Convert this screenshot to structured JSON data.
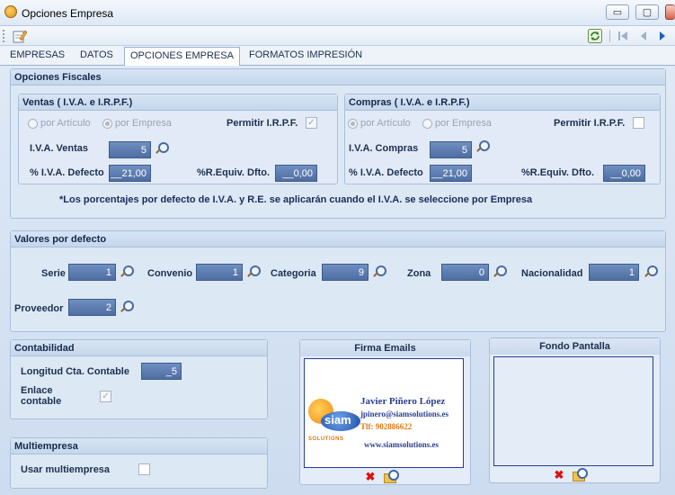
{
  "window": {
    "title": "Opciones Empresa",
    "minimize": "▭",
    "maximize": "▢",
    "close": "✕"
  },
  "toolbar": {
    "edit_icon": "edit-icon",
    "refresh_icon": "refresh-icon",
    "first_icon": "first-record-icon",
    "prev_icon": "prev-icon",
    "next_icon": "next-icon"
  },
  "tabs": [
    {
      "label": "EMPRESAS"
    },
    {
      "label": "DATOS"
    },
    {
      "label": "OPCIONES EMPRESA"
    },
    {
      "label": "FORMATOS IMPRESIÓN"
    }
  ],
  "fiscal": {
    "title": "Opciones Fiscales",
    "ventas": {
      "title": "Ventas ( I.V.A. e I.R.P.F.)",
      "radio_articulo": "por Artículo",
      "radio_empresa": "por Empresa",
      "permitir_irpf": "Permitir I.R.P.F.",
      "iva_label": "I.V.A. Ventas",
      "iva_value": "5",
      "pct_iva_label": "% I.V.A. Defecto",
      "pct_iva_value": "__21,00",
      "req_label": "%R.Equiv. Dfto.",
      "req_value": "__0,00"
    },
    "compras": {
      "title": "Compras ( I.V.A. e I.R.P.F.)",
      "radio_articulo": "por Artículo",
      "radio_empresa": "por Empresa",
      "permitir_irpf": "Permitir I.R.P.F.",
      "iva_label": "I.V.A. Compras",
      "iva_value": "5",
      "pct_iva_label": "% I.V.A. Defecto",
      "pct_iva_value": "__21,00",
      "req_label": "%R.Equiv. Dfto.",
      "req_value": "__0,00"
    },
    "note": "*Los porcentajes por defecto de I.V.A. y R.E. se aplicarán cuando el I.V.A. se seleccione por Empresa"
  },
  "defaults": {
    "title": "Valores por defecto",
    "serie_label": "Serie",
    "serie_value": "1",
    "convenio_label": "Convenio",
    "convenio_value": "1",
    "categoria_label": "Categoria",
    "categoria_value": "9",
    "zona_label": "Zona",
    "zona_value": "0",
    "nacionalidad_label": "Nacionalidad",
    "nacionalidad_value": "1",
    "proveedor_label": "Proveedor",
    "proveedor_value": "2"
  },
  "contabilidad": {
    "title": "Contabilidad",
    "longitud_label": "Longitud Cta. Contable",
    "longitud_value": "_5",
    "enlace_label_1": "Enlace",
    "enlace_label_2": "contable"
  },
  "multiempresa": {
    "title": "Multiempresa",
    "usar_label": "Usar multiempresa"
  },
  "firma": {
    "title": "Firma Emails",
    "name": "Javier Piñero López",
    "email": "jpinero@siamsolutions.es",
    "phone": "Tlf: 902886622",
    "web": "www.siamsolutions.es",
    "logo_text": "siam",
    "logo_sub": "SOLUTIONS"
  },
  "fondo": {
    "title": "Fondo Pantalla"
  },
  "colors": {
    "field_bg": "#5b7ab0",
    "accent_text": "#2a3f8f",
    "signature_orange": "#e07a10"
  }
}
